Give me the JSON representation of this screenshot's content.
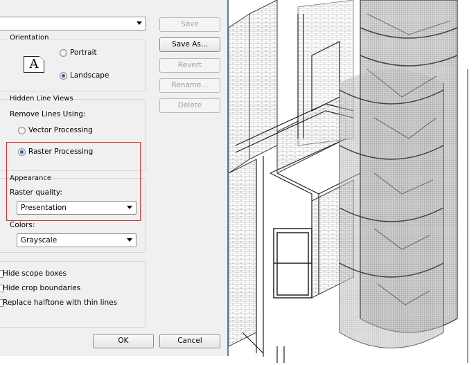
{
  "dialog": {
    "top_select_value": "",
    "orientation": {
      "title": "Orientation",
      "icon_letter": "A",
      "portrait_label": "Portrait",
      "landscape_label": "Landscape",
      "selected": "Landscape"
    },
    "hidden_line": {
      "title": "Hidden Line Views",
      "remove_lines_label": "Remove Lines Using:",
      "vector_label": "Vector Processing",
      "raster_label": "Raster Processing",
      "selected": "Raster Processing"
    },
    "appearance": {
      "title": "Appearance",
      "raster_quality_label": "Raster quality:",
      "raster_quality_value": "Presentation",
      "colors_label": "Colors:",
      "colors_value": "Grayscale"
    },
    "options": {
      "hide_scope_boxes": "Hide scope boxes",
      "hide_crop_boundaries": "Hide crop boundaries",
      "replace_halftone": "Replace halftone with thin lines"
    },
    "buttons": {
      "save": "Save",
      "save_as": "Save As...",
      "revert": "Revert",
      "rename": "Rename...",
      "delete": "Delete",
      "ok": "OK",
      "cancel": "Cancel"
    },
    "highlight_color": "#d9312c",
    "accent_color": "#2d5db3"
  }
}
